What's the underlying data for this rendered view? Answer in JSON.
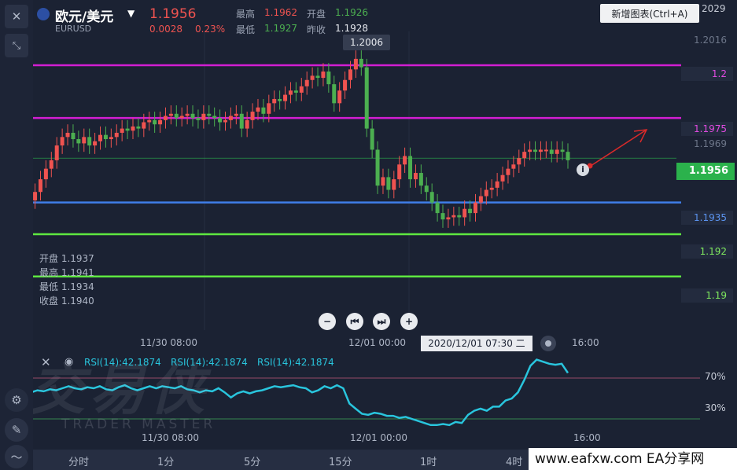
{
  "header": {
    "title": "欧元/美元",
    "symbol": "EURUSD",
    "price": "1.1956",
    "change": "0.0028",
    "change_pct": "0.23%",
    "high_label": "最高",
    "high": "1.1962",
    "open_label": "开盘",
    "open": "1.1926",
    "low_label": "最低",
    "low": "1.1927",
    "prev_close_label": "昨收",
    "prev_close": "1.1928",
    "new_chart_button": "新增图表(Ctrl+A)",
    "top_axis_value": "2029"
  },
  "price_axis": {
    "tick_1_2016": "1.2016",
    "line_1_2": "1.2",
    "line_1_1975": "1.1975",
    "tick_1_1969": "1.1969",
    "current_price": "1.1956",
    "line_1_1935": "1.1935",
    "line_1_192": "1.192",
    "line_1_19": "1.19"
  },
  "high_marker": "1.2006",
  "ohlc_popup": {
    "open": "开盘 1.1937",
    "high": "最高 1.1941",
    "low": "最低 1.1934",
    "close": "收盘 1.1940"
  },
  "nav": {
    "zoom_out": "−",
    "prev": "⏮",
    "next": "⏭",
    "zoom_in": "+"
  },
  "time_axis": {
    "t1": "11/30 08:00",
    "t2": "12/01 00:00",
    "crosshair": "2020/12/01 07:30 二",
    "t3": "16:00"
  },
  "rsi": {
    "label_1": "RSI(14):42.1874",
    "label_2": "RSI(14):42.1874",
    "label_3": "RSI(14):42.1874",
    "level_70": "70%",
    "level_30": "30%"
  },
  "bottom_time_axis": {
    "t1": "11/30 08:00",
    "t2": "12/01 00:00",
    "t3": "16:00"
  },
  "timeframe_tabs": [
    "分时",
    "1分",
    "5分",
    "15分",
    "1时",
    "4时"
  ],
  "watermark": {
    "main": "交易侠",
    "sub": "TRADER MASTER"
  },
  "footer": "www.eafxw.com  EA分享网",
  "icons": [
    "close-icon",
    "collapse-icon",
    "flag-icon",
    "dropdown-icon",
    "eye-icon",
    "settings-icon",
    "edit-icon",
    "indicator-icon",
    "info-icon"
  ],
  "colors": {
    "bull": "#ef5350",
    "bear": "#4caf50",
    "line_magenta": "#d21ed2",
    "line_blue": "#3f7ee8",
    "line_green": "#5ee840",
    "rsi_line": "#29c5dd",
    "arrow": "#d92a2a"
  },
  "chart_data": {
    "type": "candlestick",
    "price_range": [
      1.1888,
      1.2029
    ],
    "horizontal_levels": [
      1.2,
      1.1975,
      1.1935,
      1.192,
      1.19
    ],
    "closes": [
      1.1918,
      1.1922,
      1.1926,
      1.1931,
      1.1936,
      1.194,
      1.1946,
      1.1951,
      1.1955,
      1.1962,
      1.1966,
      1.1968,
      1.1965,
      1.1963,
      1.1966,
      1.1962,
      1.1964,
      1.1967,
      1.1965,
      1.1966,
      1.1968,
      1.197,
      1.1969,
      1.1971,
      1.197,
      1.1973,
      1.1974,
      1.1972,
      1.1974,
      1.1976,
      1.1977,
      1.1975,
      1.1976,
      1.1977,
      1.1975,
      1.1974,
      1.1977,
      1.1976,
      1.1975,
      1.1973,
      1.1974,
      1.1976,
      1.1977,
      1.197,
      1.1974,
      1.1978,
      1.198,
      1.1977,
      1.1982,
      1.1984,
      1.1983,
      1.1986,
      1.1988,
      1.1987,
      1.199,
      1.1993,
      1.1995,
      1.1994,
      1.1997,
      1.1991,
      1.1982,
      1.1988,
      1.1993,
      1.1998,
      1.2003,
      1.1999,
      1.197,
      1.196,
      1.1943,
      1.1947,
      1.1941,
      1.1946,
      1.1953,
      1.1957,
      1.1946,
      1.1949,
      1.1943,
      1.194,
      1.1935,
      1.193,
      1.1927,
      1.1928,
      1.1929,
      1.1928,
      1.1932,
      1.193,
      1.1935,
      1.1938,
      1.1941,
      1.1942,
      1.1945,
      1.1948,
      1.1951,
      1.1953,
      1.1956,
      1.1959,
      1.196,
      1.1959,
      1.196,
      1.196,
      1.1958,
      1.196,
      1.1959,
      1.1955
    ],
    "rsi_range": [
      0,
      100
    ],
    "rsi_levels": [
      70,
      30
    ],
    "rsi_values": [
      55,
      54,
      56,
      58,
      57,
      56,
      58,
      57,
      59,
      58,
      60,
      62,
      60,
      59,
      61,
      60,
      62,
      59,
      58,
      61,
      63,
      60,
      58,
      60,
      62,
      60,
      62,
      61,
      60,
      62,
      59,
      58,
      56,
      58,
      57,
      60,
      56,
      51,
      55,
      57,
      55,
      57,
      58,
      60,
      62,
      61,
      62,
      63,
      61,
      60,
      56,
      58,
      62,
      60,
      63,
      60,
      45,
      40,
      35,
      34,
      36,
      35,
      33,
      33,
      31,
      32,
      30,
      28,
      26,
      24,
      24,
      25,
      24,
      27,
      26,
      34,
      38,
      40,
      38,
      42,
      42,
      48,
      50,
      56,
      68,
      82,
      88,
      86,
      84,
      83,
      84,
      75
    ]
  }
}
